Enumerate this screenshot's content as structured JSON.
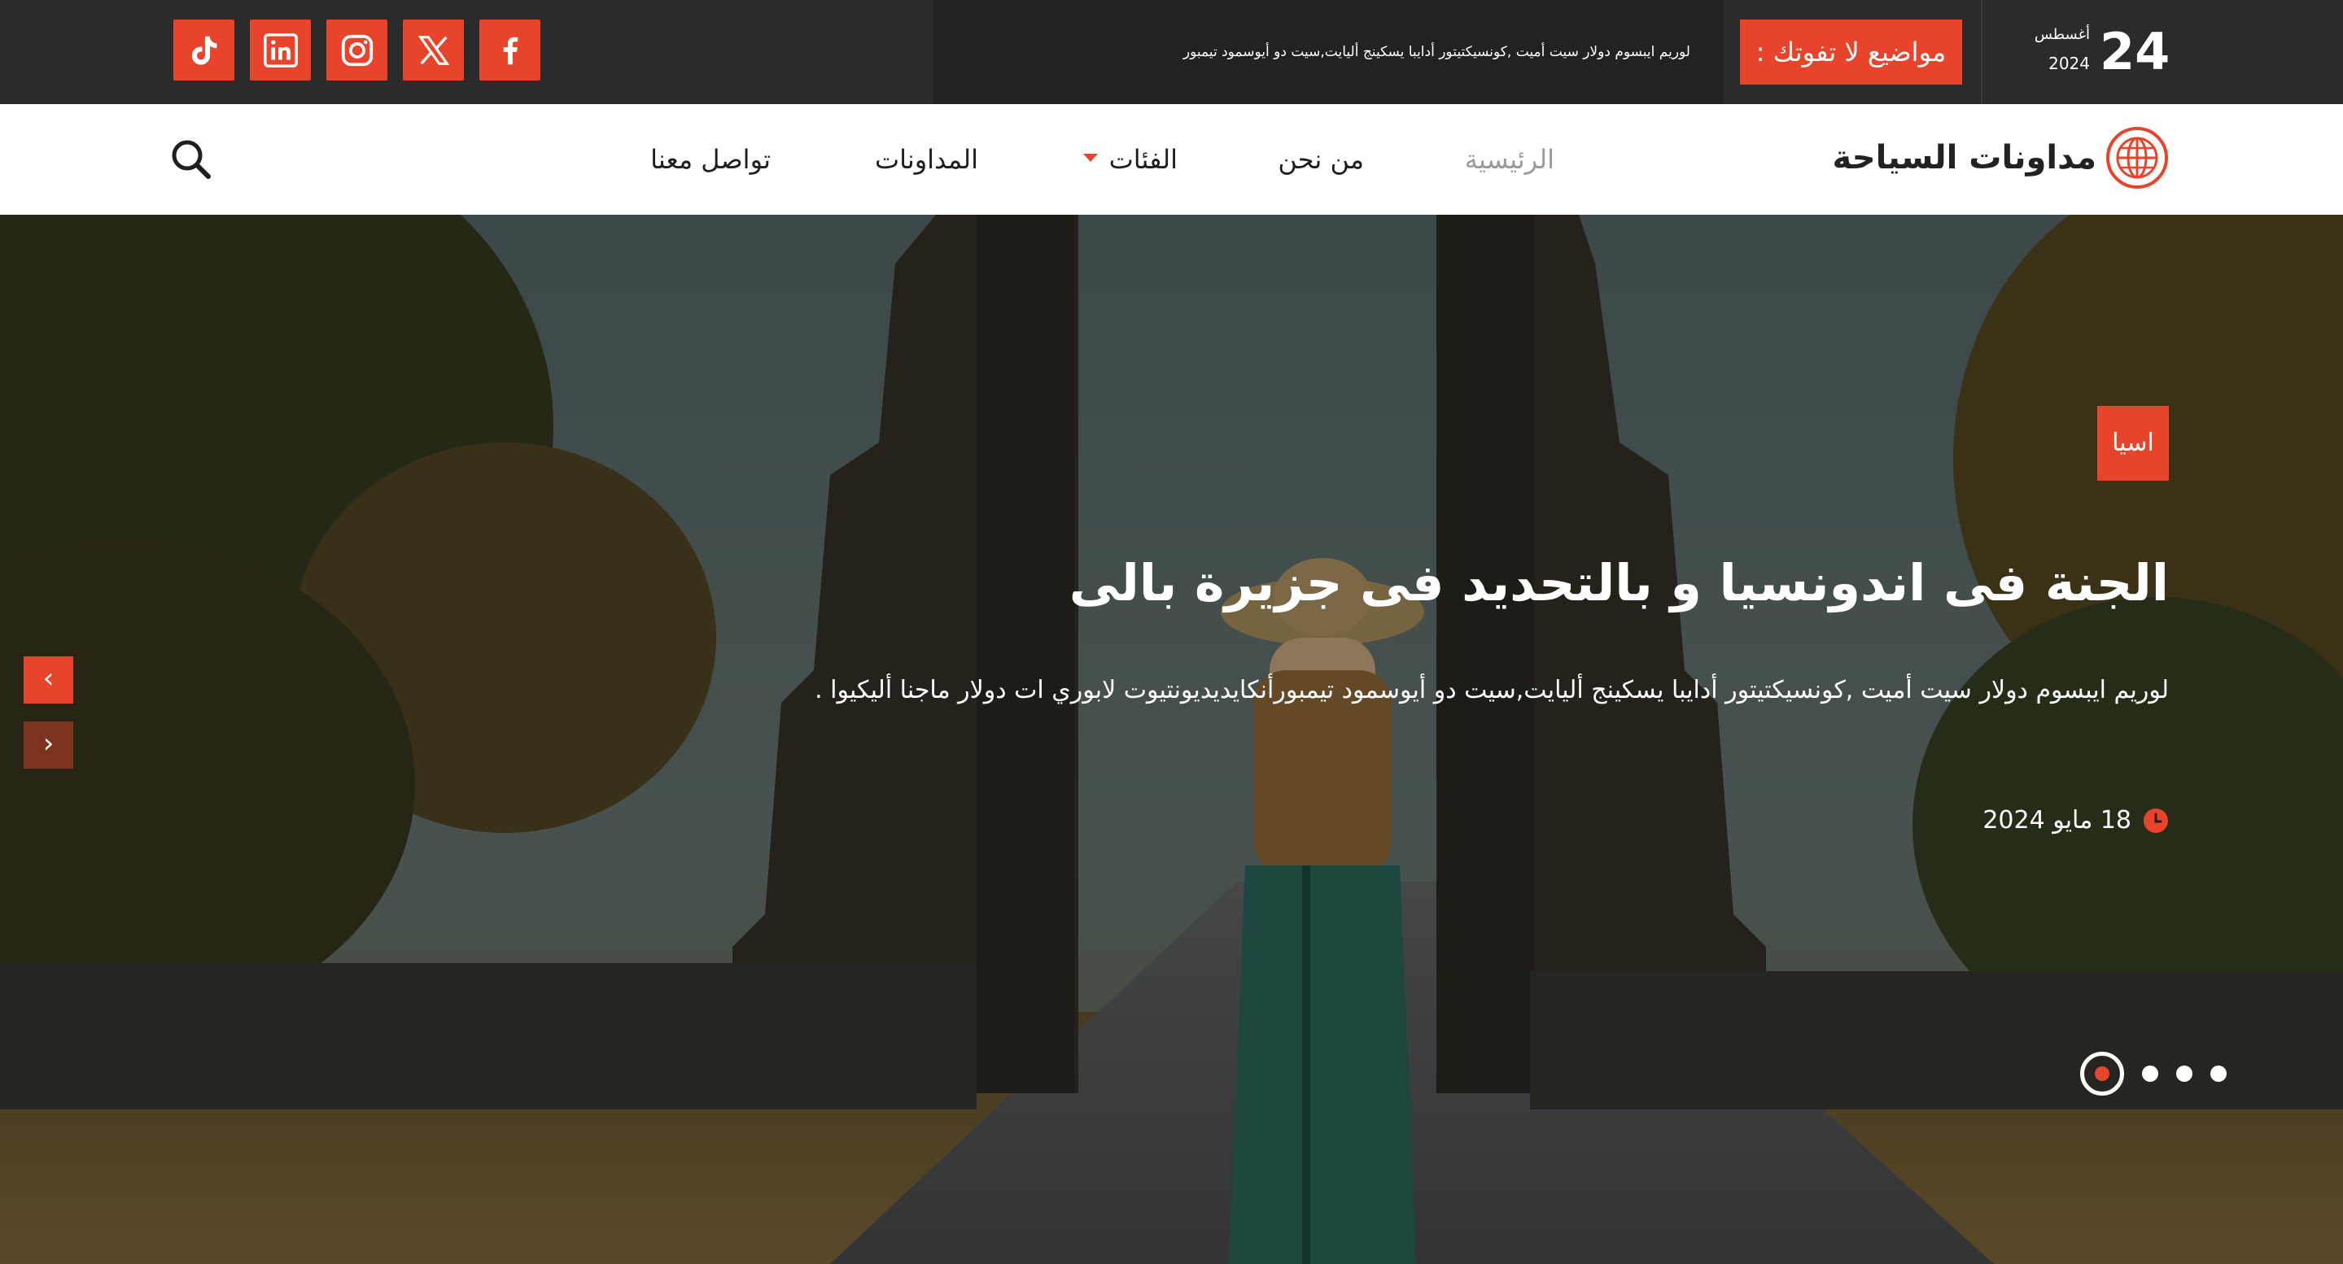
{
  "topbar": {
    "date": {
      "day": "24",
      "month": "أغسطس",
      "year": "2024"
    },
    "dont_miss_label": "مواضيع لا تفوتك :",
    "ticker_text": "لوريم ايبسوم دولار سيت أميت ,كونسيكتيتور أدايبا يسكينج أليايت,سيت دو أيوسمود تيمبور",
    "social": [
      {
        "name": "facebook",
        "icon": "facebook-icon"
      },
      {
        "name": "x",
        "icon": "x-icon"
      },
      {
        "name": "instagram",
        "icon": "instagram-icon"
      },
      {
        "name": "linkedin",
        "icon": "linkedin-icon"
      },
      {
        "name": "tiktok",
        "icon": "tiktok-icon"
      }
    ]
  },
  "navbar": {
    "logo_text": "مداونات السياحة",
    "items": [
      {
        "label": "الرئيسية",
        "active": true
      },
      {
        "label": "من نحن"
      },
      {
        "label": "الفئات",
        "has_dropdown": true
      },
      {
        "label": "المداونات"
      },
      {
        "label": "تواصل معنا"
      }
    ],
    "search_icon": "search-icon"
  },
  "hero": {
    "category": "اسيا",
    "title": "الجنة فى اندونسيا و بالتحديد فى جزيرة بالى",
    "excerpt": "لوريم ايبسوم دولار سيت أميت ,كونسيكتيتور أدايبا يسكينج أليايت,سيت دو أيوسمود تيمبورأنكايديديونتيوت لابوري ات دولار ماجنا أليكيوا .",
    "date": "18 مايو 2024",
    "prev_arrow": "‹",
    "next_arrow": "›",
    "slides_count": 4,
    "active_slide": 0
  },
  "colors": {
    "accent": "#e8442b",
    "topbar": "#2b2b2b",
    "nav_bg": "#ffffff"
  }
}
